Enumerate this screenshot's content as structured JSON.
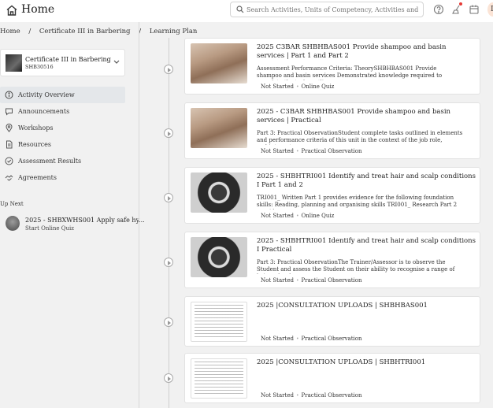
{
  "header": {
    "title": "Home",
    "search_placeholder": "Search Activities, Units of Competency, Activities and R...",
    "avatar_initial": "I"
  },
  "breadcrumb": {
    "items": [
      "Home",
      "Certificate III in Barbering",
      "Learning Plan"
    ]
  },
  "sidebar": {
    "course": {
      "title": "Certificate III in Barbering",
      "code": "SHB30516"
    },
    "items": [
      {
        "label": "Activity Overview",
        "icon": "info-circle-icon"
      },
      {
        "label": "Announcements",
        "icon": "chat-bubble-icon"
      },
      {
        "label": "Workshops",
        "icon": "map-pin-icon"
      },
      {
        "label": "Resources",
        "icon": "document-icon"
      },
      {
        "label": "Assessment Results",
        "icon": "check-circle-icon"
      },
      {
        "label": "Agreements",
        "icon": "handshake-icon"
      }
    ],
    "up_next": {
      "label": "Up Next",
      "title": "2025 - SHBXWHS001 Apply safe hy...",
      "subtitle": "Start Online Quiz"
    }
  },
  "activities": [
    {
      "title": "2025 C3BAR SHBHBAS001 Provide shampoo and basin services | Part 1 and Part 2",
      "description": "Assessment Performance Criteria: TheorySHBHBAS001 Provide shampoo and basin services Demonstrated knowledge required to complete the tasks outline...",
      "status": "Not Started",
      "type": "Online Quiz"
    },
    {
      "title": "2025 - C3BAR SHBHBAS001 Provide shampoo and basin services | Practical",
      "description": "Part 3: Practical ObservationStudent complete tasks outlined in elements and performance criteria of this unit in the context of the job role, and:integrate...",
      "status": "Not Started",
      "type": "Practical Observation"
    },
    {
      "title": "2025 - SHBHTRI001 Identify and treat hair and scalp conditions I Part 1 and 2",
      "description": "TRI001_ Written Part 1 provides evidence for the following foundation skills: Reading, planning and organising skills TRI001_ Research Part 2 provides...",
      "status": "Not Started",
      "type": "Online Quiz"
    },
    {
      "title": "2025 - SHBHTRI001 Identify and treat hair and scalp conditions I Practical",
      "description": "Part 3: Practical ObservationThe Trainer/Assessor is to observe the Student and assess the Student on their ability to recognise a range of hair andscalp...",
      "status": "Not Started",
      "type": "Practical Observation"
    },
    {
      "title": "2025 |CONSULTATION UPLOADS | SHBHBAS001",
      "description": "",
      "status": "Not Started",
      "type": "Practical Observation"
    },
    {
      "title": "2025 |CONSULTATION UPLOADS | SHBHTRI001",
      "description": "",
      "status": "Not Started",
      "type": "Practical Observation"
    }
  ]
}
